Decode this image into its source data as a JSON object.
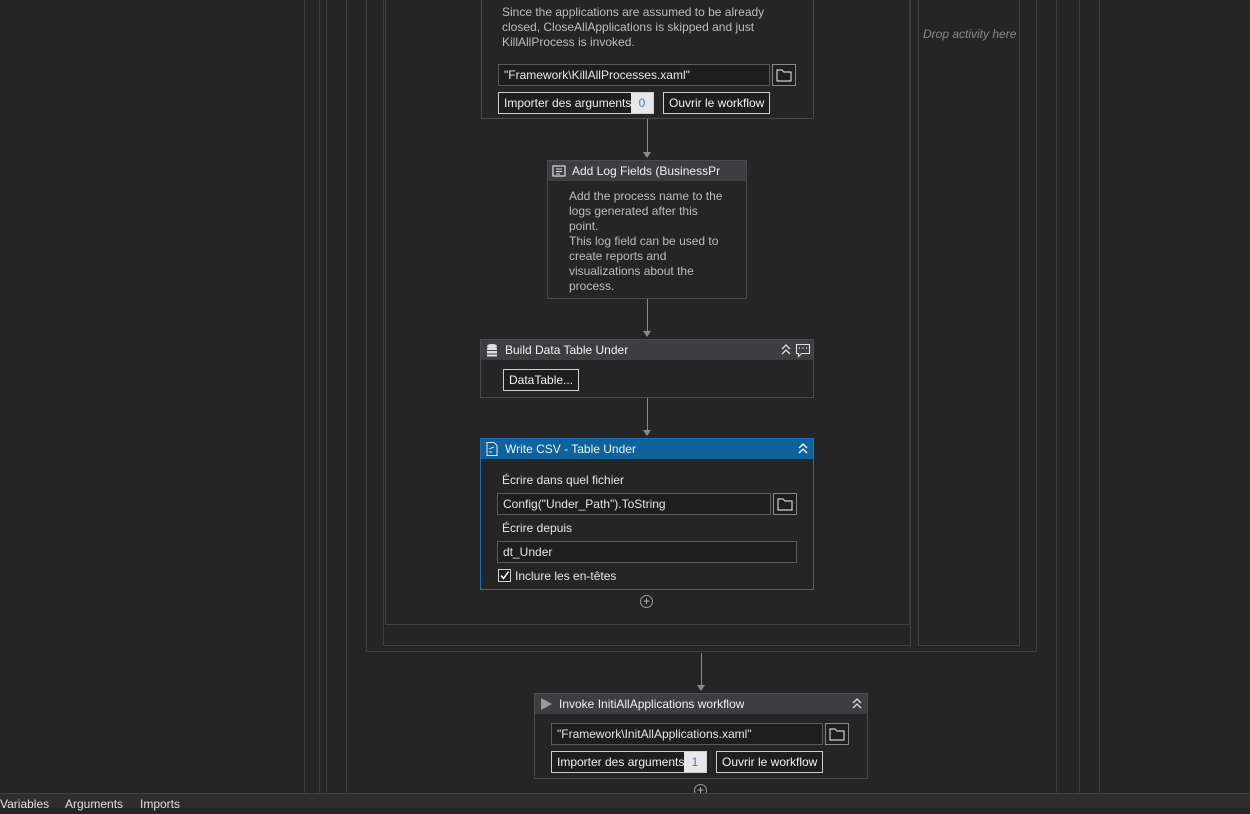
{
  "kill_process": {
    "description_lines": [
      "Since the applications are assumed to be already",
      "closed, CloseAllApplications is skipped and just",
      "KillAllProcess is invoked."
    ],
    "path_value": "\"Framework\\KillAllProcesses.xaml\"",
    "import_label": "Importer des arguments",
    "import_count": "0",
    "open_label": "Ouvrir le workflow"
  },
  "drop_hint": "Drop activity here",
  "add_log_fields": {
    "title": "Add Log Fields (BusinessPr",
    "description_lines": [
      "Add the process name to the",
      "logs generated after this",
      "point.",
      "This log field can be used to",
      "create reports and",
      "visualizations about the",
      "process."
    ]
  },
  "build_data_table": {
    "title": "Build Data Table Under",
    "button_label": "DataTable..."
  },
  "write_csv": {
    "title": "Write CSV - Table Under",
    "file_label": "Écrire dans quel fichier",
    "file_value": "Config(\"Under_Path\").ToString",
    "from_label": "Écrire depuis",
    "from_value": "dt_Under",
    "headers_label": "Inclure les en-têtes",
    "headers_checked": true
  },
  "invoke_init": {
    "title": "Invoke InitiAllApplications workflow",
    "path_value": "\"Framework\\InitAllApplications.xaml\"",
    "import_label": "Importer des arguments",
    "import_count": "1",
    "open_label": "Ouvrir le workflow"
  },
  "bottom_tabs": [
    "Variables",
    "Arguments",
    "Imports"
  ],
  "icons": {
    "folder": "folder-icon",
    "log": "log-fields-icon",
    "table": "data-table-icon",
    "csv": "write-csv-icon",
    "invoke": "invoke-play-icon",
    "collapse": "double-chevron-up-icon",
    "annotation": "annotation-icon",
    "add": "add-circle-icon",
    "check": "checkmark-icon"
  },
  "colors": {
    "canvas": "#252526",
    "header": "#3e3e42",
    "selected_header": "#0e639c",
    "border": "#4a4a4f"
  }
}
